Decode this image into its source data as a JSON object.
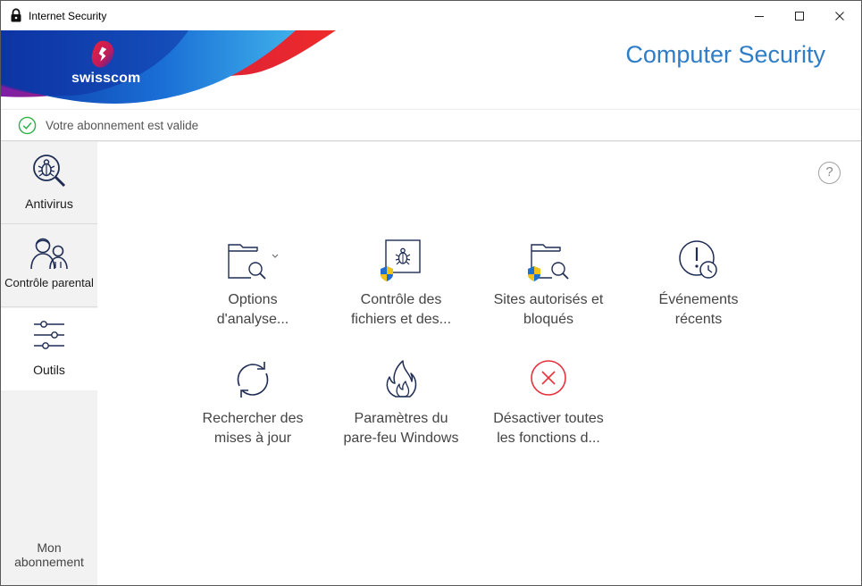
{
  "window": {
    "title": "Internet Security",
    "icons": {
      "app": "lock-icon",
      "minimize": "minimize-icon",
      "maximize": "maximize-icon",
      "close": "close-icon"
    }
  },
  "header": {
    "brand": "swisscom",
    "product_title": "Computer Security"
  },
  "status": {
    "text": "Votre abonnement est valide",
    "icon": "check-circle-icon",
    "color": "#2fb34a"
  },
  "sidebar": {
    "items": [
      {
        "label": "Antivirus",
        "icon": "bug-magnifier-icon",
        "selected": false
      },
      {
        "label": "Contrôle parental",
        "icon": "parent-child-icon",
        "selected": false
      },
      {
        "label": "Outils",
        "icon": "sliders-icon",
        "selected": true
      }
    ],
    "subscription_line1": "Mon",
    "subscription_line2": "abonnement"
  },
  "main": {
    "help_label": "?",
    "tools": [
      {
        "line1": "Options",
        "line2": "d'analyse...",
        "icon": "folder-search-icon",
        "has_dropdown": true
      },
      {
        "line1": "Contrôle des",
        "line2": "fichiers et des...",
        "icon": "bug-shield-icon"
      },
      {
        "line1": "Sites autorisés et",
        "line2": "bloqués",
        "icon": "folder-search-shield-icon"
      },
      {
        "line1": "Événements",
        "line2": "récents",
        "icon": "alert-clock-icon"
      },
      {
        "line1": "Rechercher des",
        "line2": "mises à jour",
        "icon": "refresh-icon"
      },
      {
        "line1": "Paramètres du",
        "line2": "pare-feu Windows",
        "icon": "flame-icon"
      },
      {
        "line1": "Désactiver toutes",
        "line2": "les fonctions d...",
        "icon": "x-circle-icon"
      }
    ]
  },
  "colors": {
    "accent_blue": "#2e7dc6",
    "icon_navy": "#1f2d55",
    "danger_red": "#e8323c",
    "sidebar_bg": "#f2f2f2"
  }
}
